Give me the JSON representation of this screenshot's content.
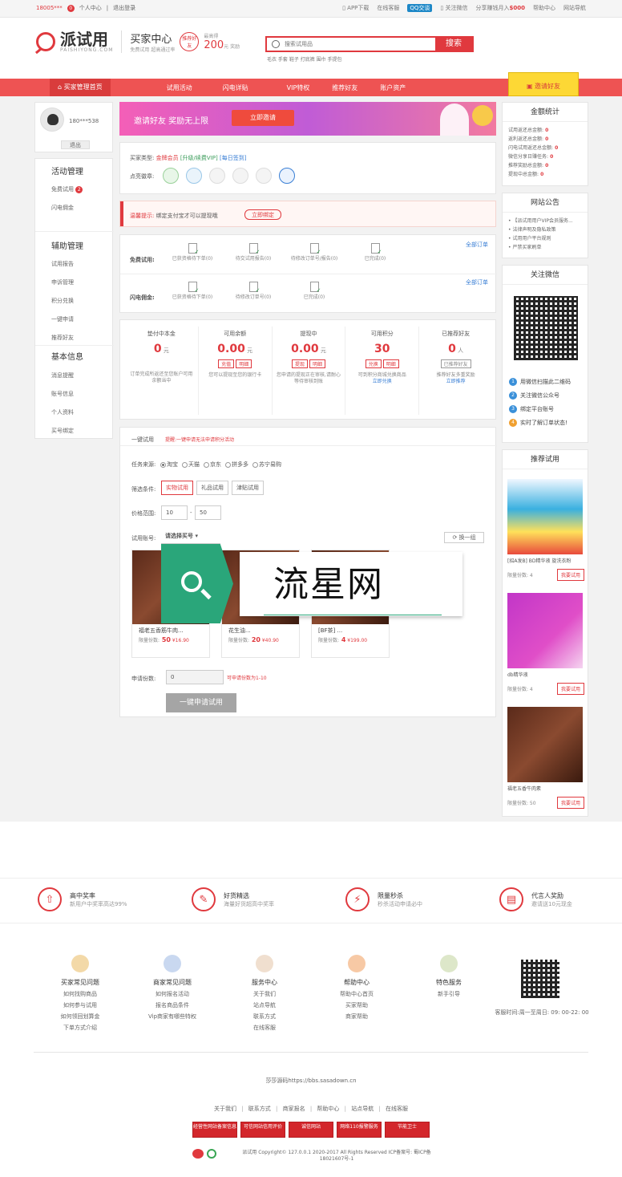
{
  "topbar": {
    "account": "18005***",
    "msg_count": "0",
    "personal": "个人中心",
    "logout": "退出登录",
    "app": "APP下载",
    "service": "在线客服",
    "qq": "QQ交谈",
    "wechat": "关注微信",
    "share": "分享赚钱月入",
    "share_amount": "$000",
    "help": "帮助中心",
    "nav": "网站导航"
  },
  "header": {
    "logo_cn": "派试用",
    "logo_en": "PAISHIYONG.COM",
    "seller_title": "买家中心",
    "seller_sub": "免费试用 超高通过率",
    "invite_badge": "推荐好友",
    "reward_label": "最高得",
    "reward_amount": "200",
    "reward_unit": "元 奖励",
    "search_placeholder": "搜索试用品",
    "search_btn": "搜索",
    "hotwords": "毛衣 手套 鞋子 打底裤 围巾 手提包"
  },
  "nav": {
    "items": [
      "买家管理首页",
      "试用活动",
      "闪电详贴",
      "VIP特权",
      "推荐好友",
      "账户资产"
    ],
    "invite": "邀请好友"
  },
  "user": {
    "phone": "180***538",
    "logout": "退出"
  },
  "sidebar": {
    "groups": [
      {
        "title": "活动管理",
        "items": [
          "免费试用",
          "闪电佣金"
        ],
        "badge": "2"
      },
      {
        "title": "辅助管理",
        "items": [
          "试用报告",
          "申诉管理",
          "积分兑换",
          "一键申请",
          "推荐好友"
        ]
      },
      {
        "title": "基本信息",
        "items": [
          "消息提醒",
          "账号信息",
          "个人资料",
          "买号绑定"
        ]
      }
    ]
  },
  "banner": {
    "text": "邀请好友 奖励无上限",
    "btn": "立即邀请"
  },
  "buyer": {
    "type_label": "买家类型:",
    "type_value": "金牌会员",
    "upgrade": "[升级/续费VIP]",
    "sign": "[每日签到]",
    "badge_label": "点亮徽章:"
  },
  "tip": {
    "title": "温馨提示:",
    "text": "绑定支付宝才可以提现哦",
    "btn": "立即绑定"
  },
  "orders": {
    "all": "全部订单",
    "free_label": "免费试用:",
    "free_items": [
      "已获资格待下单(0)",
      "待交试用报告(0)",
      "待修改订单号/报告(0)",
      "已完成(0)"
    ],
    "flash_label": "闪电佣金:",
    "flash_items": [
      "已获资格待下单(0)",
      "待修改订单号(0)",
      "已完成(0)"
    ]
  },
  "stats": [
    {
      "title": "垫付中本金",
      "value": "0",
      "unit": "元",
      "note": "订单完成所返还至您账户可用余额当中"
    },
    {
      "title": "可用余额",
      "value": "0.00",
      "unit": "元",
      "tags": [
        "充值",
        "明细"
      ],
      "note": "您可以提现至您的银行卡"
    },
    {
      "title": "提现中",
      "value": "0.00",
      "unit": "元",
      "tags": [
        "提现",
        "明细"
      ],
      "note": "您申请的提现正在审核,请耐心等待审核到账"
    },
    {
      "title": "可用积分",
      "value": "30",
      "unit": "",
      "tags": [
        "兑换",
        "明细"
      ],
      "note": "可到积分商城兑换商品",
      "link": "立即兑换"
    },
    {
      "title": "已推荐好友",
      "value": "0",
      "unit": "人",
      "tags": [
        "已推荐好友"
      ],
      "note": "推荐好友多重奖励",
      "link": "立即推荐"
    }
  ],
  "apply": {
    "title": "一键试用",
    "hint": "提醒:一键申请无法申请积分活动",
    "source_label": "任务来源:",
    "sources": [
      "淘宝",
      "天猫",
      "京东",
      "拼多多",
      "苏宁易购"
    ],
    "filter_label": "筛选条件:",
    "filters": [
      "实物试用",
      "礼品试用",
      "津贴试用"
    ],
    "price_label": "价格范围:",
    "price_min": "10",
    "price_sep": "-",
    "price_max": "50",
    "account_label": "试用账号:",
    "account_select": "请选择买号",
    "refresh": "换一组",
    "products": [
      {
        "name": "福老五香筋牛肉...",
        "points": "50",
        "price": "¥16.90"
      },
      {
        "name": "花生油...",
        "points": "20",
        "price": "¥40.90"
      },
      {
        "name": "[BF茶] ...",
        "points": "4",
        "price": "¥199.00"
      }
    ],
    "points_label": "限量份数:",
    "count_label": "申请份数:",
    "count_value": "0",
    "count_hint": "可申请份数为1-10",
    "submit": "一键申请试用"
  },
  "watermark": "流星网",
  "right": {
    "stats_title": "金额统计",
    "stats_items": [
      "试用返还总金额:",
      "返利返还总金额:",
      "闪电试用返还总金额:",
      "微信分享日赚任务:",
      "推荐奖励总金额:",
      "提现中总金额:"
    ],
    "stats_values": [
      "0",
      "0",
      "0",
      "0",
      "0",
      "0"
    ],
    "notice_title": "网站公告",
    "notices": [
      "【派试用用户VIP会员服务...",
      "法律声明及隐私政策",
      "试用用户平台规则",
      "严禁买家刷单"
    ],
    "wechat_title": "关注微信",
    "steps": [
      "用微信扫描此二维码",
      "关注微信公众号",
      "绑定平台账号",
      "实时了解订单状态!"
    ],
    "recommend_title": "推荐试用",
    "recommend": [
      {
        "name": "[招A发B] BD精华液 旋洗衣粉",
        "points": "4"
      },
      {
        "name": "db精华液",
        "points": "4"
      },
      {
        "name": "福老五香牛肉素",
        "points": "50"
      }
    ],
    "points_label": "限量份数:",
    "apply_btn": "我要试用"
  },
  "features": [
    {
      "title": "高中奖率",
      "sub": "新用户中奖率高达99%",
      "icon": "up-arrow-icon"
    },
    {
      "title": "好货精选",
      "sub": "海量好货超高中奖率",
      "icon": "gift-icon"
    },
    {
      "title": "限量秒杀",
      "sub": "秒杀活动申请必中",
      "icon": "lightning-icon"
    },
    {
      "title": "代言人奖励",
      "sub": "邀请送10元现金",
      "icon": "wallet-icon"
    }
  ],
  "footer": {
    "cols": [
      {
        "title": "买家常见问题",
        "items": [
          "如何找购商品",
          "如何参与试用",
          "如何领回划算金",
          "下单方式介绍"
        ]
      },
      {
        "title": "商家常见问题",
        "items": [
          "如何报名活动",
          "报名商品条件",
          "Vip商家有哪些特权"
        ]
      },
      {
        "title": "服务中心",
        "items": [
          "关于我们",
          "站点导航",
          "联系方式",
          "在线客服"
        ]
      },
      {
        "title": "帮助中心",
        "items": [
          "帮助中心首页",
          "买家帮助",
          "商家帮助"
        ]
      },
      {
        "title": "特色服务",
        "items": [
          "新手引导"
        ]
      }
    ],
    "hours": "客服时间:周一至周日: 09: 00-22: 00",
    "source": "莎莎源码https://bbs.sasadown.cn",
    "links": [
      "关于我们",
      "联系方式",
      "商家报名",
      "帮助中心",
      "站点导航",
      "在线客服"
    ],
    "badges": [
      "经营性网站备案信息",
      "可信网站信用评价",
      "诚信网站",
      "网络110报警服务",
      "节能卫士"
    ],
    "copyright": "派试用 Copyright© 127.0.0.1 2020-2017 All Rights Reserved ICP备案号: 蜀ICP备18021607号-1"
  },
  "colors": {
    "brand": "#e0393e",
    "nav": "#ee5353",
    "accent": "#fdd835",
    "watermark": "#2aa67a"
  }
}
